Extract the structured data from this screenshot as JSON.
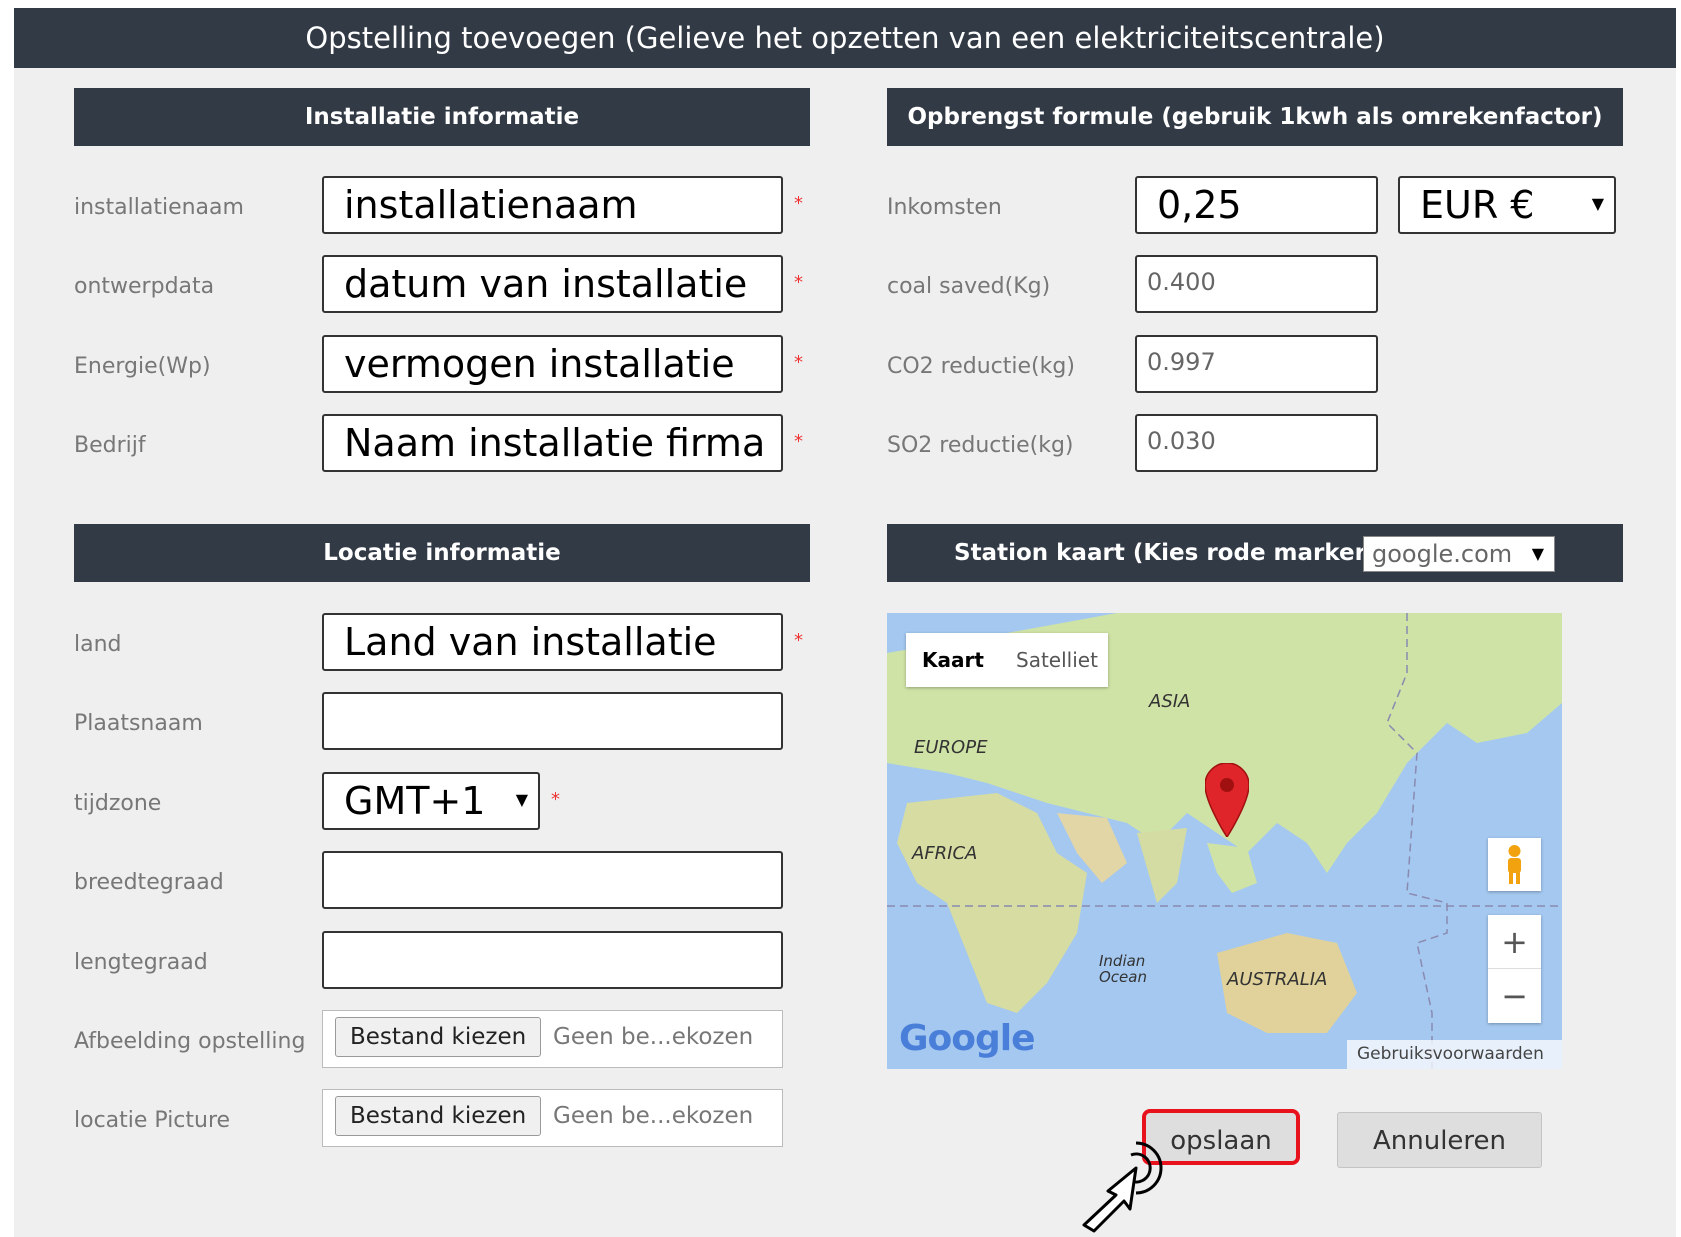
{
  "dialog": {
    "title": "Opstelling toevoegen (Gelieve het opzetten van een elektriciteitscentrale)"
  },
  "installatie": {
    "header": "Installatie informatie",
    "fields": [
      {
        "label": "installatienaam",
        "value": "installatienaam",
        "required": "*"
      },
      {
        "label": "ontwerpdata",
        "value": "datum van installatie",
        "required": "*"
      },
      {
        "label": "Energie(Wp)",
        "value": "vermogen installatie",
        "required": "*"
      },
      {
        "label": "Bedrijf",
        "value": "Naam installatie firma",
        "required": "*"
      }
    ]
  },
  "opbrengst": {
    "header": "Opbrengst formule (gebruik 1kwh als omrekenfactor)",
    "inkomsten_label": "Inkomsten",
    "inkomsten_value": "0,25",
    "currency_selected": "EUR €",
    "coal_label": "coal saved(Kg)",
    "coal_value": "0.400",
    "co2_label": "CO2 reductie(kg)",
    "co2_value": "0.997",
    "so2_label": "SO2 reductie(kg)",
    "so2_value": "0.030"
  },
  "locatie": {
    "header": "Locatie informatie",
    "land_label": "land",
    "land_value": "Land van installatie",
    "plaats_label": "Plaatsnaam",
    "tijdzone_label": "tijdzone",
    "tijdzone_value": "GMT+1",
    "breedte_label": "breedtegraad",
    "lengte_label": "lengtegraad",
    "afbeelding_label": "Afbeelding opstelling",
    "locatie_pic_label": "locatie Picture",
    "file_button": "Bestand kiezen",
    "file_none": "Geen be...ekozen",
    "required": "*"
  },
  "station_kaart": {
    "header": "Station kaart (Kies rode markering)",
    "provider_selected": "google.com",
    "map_type_kaart": "Kaart",
    "map_type_satelliet": "Satelliet",
    "labels": {
      "asia": "ASIA",
      "europe": "EUROPE",
      "africa": "AFRICA",
      "indian_ocean": "Indian Ocean",
      "australia": "AUSTRALIA"
    },
    "google_logo": "Google",
    "terms": "Gebruiksvoorwaarden",
    "zoom_in": "+",
    "zoom_out": "−"
  },
  "actions": {
    "save": "opslaan",
    "cancel": "Annuleren"
  },
  "colors": {
    "header_bg": "#323a46",
    "highlight": "#e8121d",
    "required": "#e33333"
  }
}
